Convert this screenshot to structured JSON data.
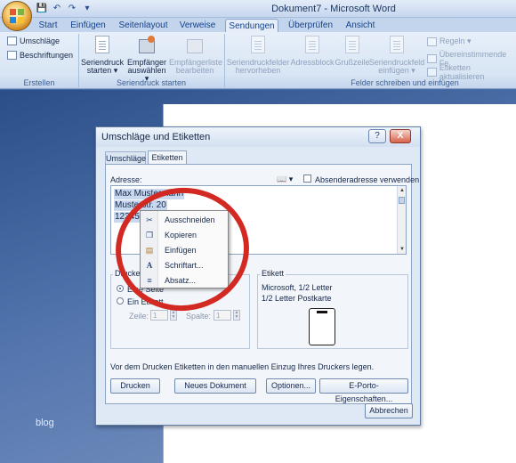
{
  "window": {
    "title": "Dokument7 - Microsoft Word",
    "qat": [
      "save-icon",
      "undo-icon",
      "redo-icon",
      "qat-dropdown-icon"
    ]
  },
  "tabs": [
    "Start",
    "Einfügen",
    "Seitenlayout",
    "Verweise",
    "Sendungen",
    "Überprüfen",
    "Ansicht"
  ],
  "active_tab": "Sendungen",
  "ribbon": {
    "erstellen": {
      "label": "Erstellen",
      "umschlaege": "Umschläge",
      "beschriftungen": "Beschriftungen"
    },
    "seriendruck_starten": {
      "label": "Seriendruck starten",
      "btn1_line1": "Seriendruck",
      "btn1_line2": "starten ▾",
      "btn2_line1": "Empfänger",
      "btn2_line2": "auswählen ▾",
      "btn3_line1": "Empfängerliste",
      "btn3_line2": "bearbeiten"
    },
    "felder": {
      "label": "Felder schreiben und einfügen",
      "hervorheben_line1": "Seriendruckfelder",
      "hervorheben_line2": "hervorheben",
      "adressblock": "Adressblock",
      "grusszeile": "Grußzeile",
      "feld_line1": "Seriendruckfeld",
      "feld_line2": "einfügen ▾",
      "regeln": "Regeln ▾",
      "uebereinstimmende": "Übereinstimmende Fe",
      "etiketten_aktualisieren": "Etiketten aktualisieren"
    }
  },
  "dialog": {
    "title": "Umschläge und Etiketten",
    "help": "?",
    "close": "X",
    "tabs": [
      "Umschläge",
      "Etiketten"
    ],
    "active_tab": "Etiketten",
    "adresse_label": "Adresse:",
    "absender_label": "Absenderadresse verwenden",
    "address_lines": [
      "Max Mustermann",
      "Musterstr. 20",
      "12345 M"
    ],
    "drucken_group": "Drucken",
    "eine_seite": "Eine Seite",
    "ein_etikett": "Ein Etikett",
    "zeile_label": "Zeile:",
    "zeile_value": "1",
    "spalte_label": "Spalte:",
    "spalte_value": "1",
    "etikett_group": "Etikett",
    "etikett_line1": "Microsoft, 1/2 Letter",
    "etikett_line2": "1/2 Letter Postkarte",
    "hint": "Vor dem Drucken Etiketten in den manuellen Einzug Ihres Druckers legen.",
    "buttons": {
      "drucken": "Drucken",
      "neues_dokument": "Neues Dokument",
      "optionen": "Optionen...",
      "eporto": "E-Porto-Eigenschaften...",
      "abbrechen": "Abbrechen"
    }
  },
  "context_menu": [
    {
      "label": "Ausschneiden",
      "icon": "scissors-icon"
    },
    {
      "label": "Kopieren",
      "icon": "copy-icon"
    },
    {
      "label": "Einfügen",
      "icon": "paste-icon"
    },
    {
      "label": "Schriftart...",
      "icon": "font-icon"
    },
    {
      "label": "Absatz...",
      "icon": "paragraph-icon"
    }
  ],
  "watermark": "blog",
  "colors": {
    "highlight_ring": "#d22a22",
    "selection": "#c7d8ef",
    "ribbon_bg": "#dbe6f4"
  }
}
